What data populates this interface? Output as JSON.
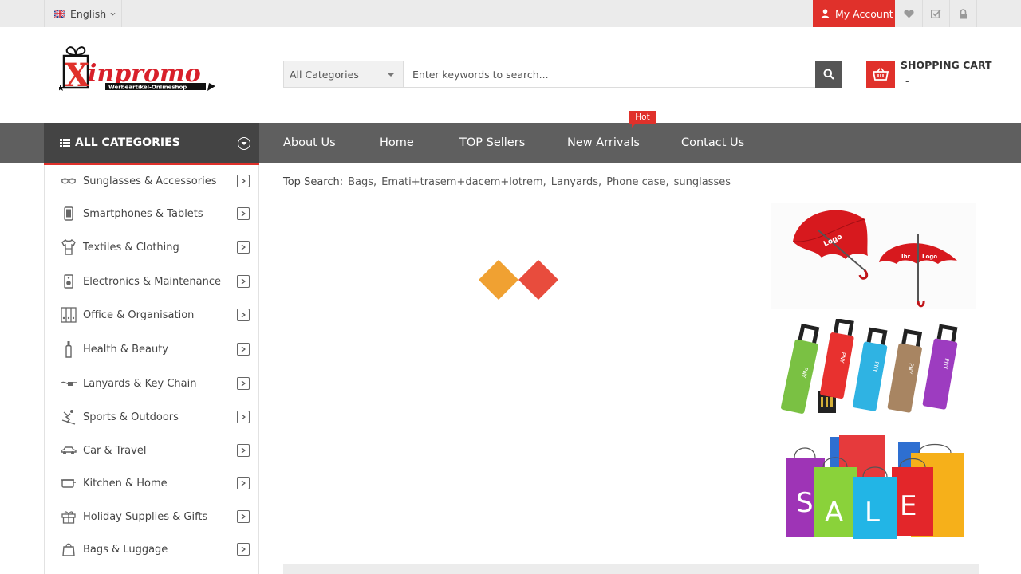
{
  "topbar": {
    "language": "English",
    "account_label": "My Account",
    "icons": [
      "heart-icon",
      "checklist-icon",
      "lock-icon"
    ]
  },
  "header": {
    "logo_text": "Xinpromo",
    "logo_tagline": "Werbeartikel-Onlineshop",
    "search": {
      "category": "All Categories",
      "placeholder": "Enter keywords to search..."
    },
    "cart": {
      "title": "SHOPPING CART",
      "subtitle": "-"
    }
  },
  "nav": {
    "all_categories": "ALL CATEGORIES",
    "items": [
      {
        "label": "About Us"
      },
      {
        "label": "Home"
      },
      {
        "label": "TOP Sellers"
      },
      {
        "label": "New Arrivals",
        "badge": "Hot"
      },
      {
        "label": "Contact Us"
      }
    ]
  },
  "sidebar": {
    "items": [
      {
        "label": "Sunglasses & Accessories",
        "icon": "glasses-icon"
      },
      {
        "label": "Smartphones & Tablets",
        "icon": "smartphone-icon"
      },
      {
        "label": "Textiles & Clothing",
        "icon": "tshirt-icon"
      },
      {
        "label": "Electronics & Maintenance",
        "icon": "speaker-icon"
      },
      {
        "label": "Office & Organisation",
        "icon": "binders-icon"
      },
      {
        "label": "Health & Beauty",
        "icon": "bottle-icon"
      },
      {
        "label": "Lanyards & Key Chain",
        "icon": "lanyard-icon"
      },
      {
        "label": "Sports & Outdoors",
        "icon": "skier-icon"
      },
      {
        "label": "Car & Travel",
        "icon": "car-icon"
      },
      {
        "label": "Kitchen & Home",
        "icon": "kitchen-icon"
      },
      {
        "label": "Holiday Supplies & Gifts",
        "icon": "gift-icon"
      },
      {
        "label": "Bags & Luggage",
        "icon": "bag-icon"
      }
    ]
  },
  "main": {
    "top_search_label": "Top Search:",
    "top_search_links": [
      "Bags,",
      "Emati+trasem+dacem+lotrem,",
      "Lanyards,",
      "Phone case,",
      "sunglasses"
    ],
    "banners": [
      {
        "name": "umbrella-banner",
        "texts": [
          "Logo",
          "Ihr",
          "Logo"
        ]
      },
      {
        "name": "usb-banner",
        "texts": [
          "PNY",
          "PNY",
          "PNY",
          "PNY",
          "PNY"
        ]
      },
      {
        "name": "sale-banner",
        "texts": [
          "S",
          "A",
          "L",
          "E"
        ]
      }
    ]
  },
  "colors": {
    "accent": "#e0312b",
    "nav_bg": "#5f5f5f",
    "allcat_bg": "#444444",
    "loader_orange": "#f0a132",
    "loader_red": "#e84c3d"
  }
}
